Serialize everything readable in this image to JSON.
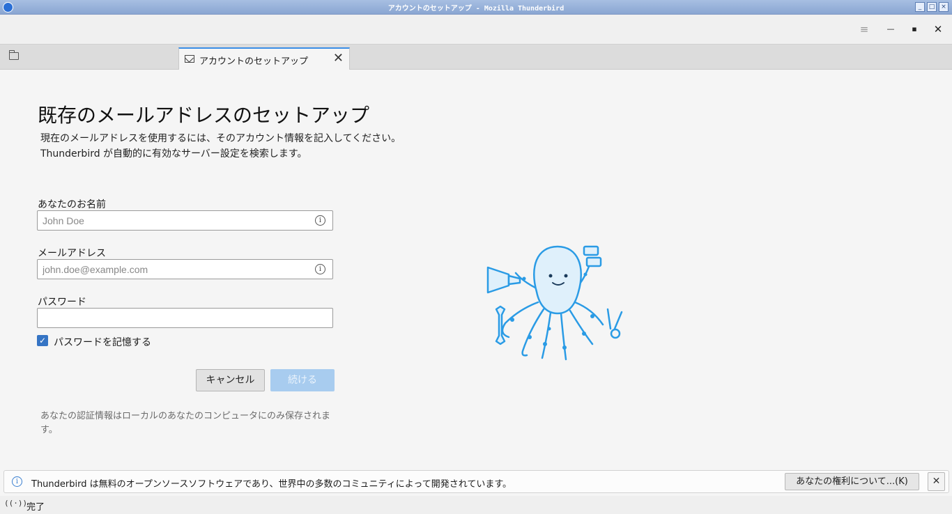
{
  "window": {
    "title": "アカウントのセットアップ - Mozilla Thunderbird",
    "min": "_",
    "max": "□",
    "close": "×"
  },
  "toolbar": {
    "menu_glyph": "≡",
    "min_glyph": "—",
    "max_glyph": "▪",
    "close_glyph": "✕"
  },
  "tabs": [
    {
      "label": "アカウントのセットアップ",
      "close": "✕"
    }
  ],
  "setup": {
    "title": "既存のメールアドレスのセットアップ",
    "desc1": "現在のメールアドレスを使用するには、そのアカウント情報を記入してください。",
    "desc2": "Thunderbird が自動的に有効なサーバー設定を検索します。",
    "name_label": "あなたのお名前",
    "name_placeholder": "John Doe",
    "email_label": "メールアドレス",
    "email_placeholder": "john.doe@example.com",
    "password_label": "パスワード",
    "password_value": "",
    "remember_label": "パスワードを記憶する",
    "remember_checked": true,
    "cancel": "キャンセル",
    "continue": "続ける",
    "note": "あなたの認証情報はローカルのあなたのコンピュータにのみ保存されます。",
    "info_glyph": "i",
    "check_glyph": "✓"
  },
  "notification": {
    "text": "Thunderbird は無料のオープンソースソフトウェアであり、世界中の多数のコミュニティによって開発されています。",
    "button": "あなたの権利について...(K)",
    "close": "✕",
    "info_glyph": "i"
  },
  "status": {
    "icon_glyph": "((·))",
    "text": "完了"
  },
  "colors": {
    "accent": "#3a8ee6",
    "mascot": "#2a9be5",
    "mascot_fill": "#dff0fb"
  }
}
